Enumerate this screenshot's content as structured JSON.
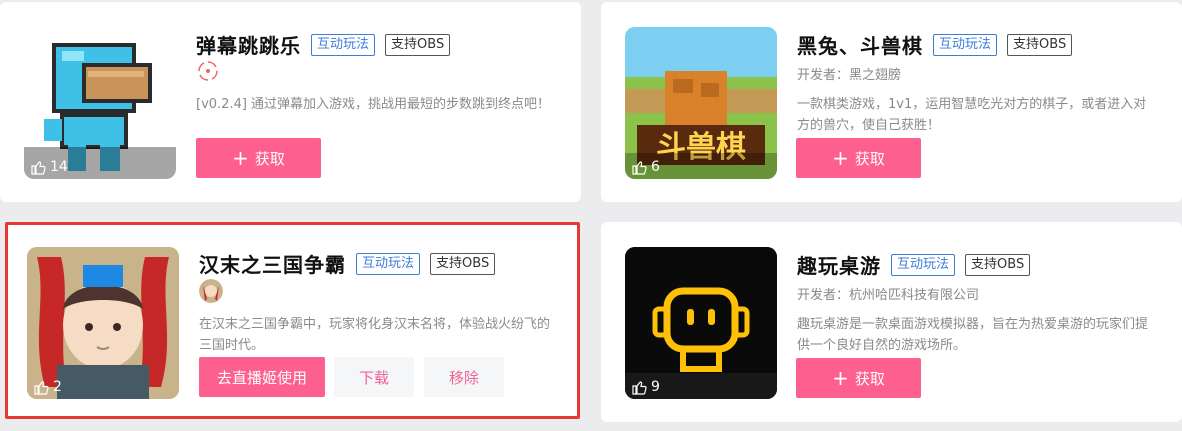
{
  "cards": [
    {
      "title": "弹幕跳跳乐",
      "tag_interactive": "互动玩法",
      "tag_obs": "支持OBS",
      "developer": "",
      "description": "[v0.2.4] 通过弹幕加入游戏，挑战用最短的步数跳到终点吧！",
      "likes": "14",
      "button": "获取",
      "button_icon": "+"
    },
    {
      "title": "黑兔、斗兽棋",
      "tag_interactive": "互动玩法",
      "tag_obs": "支持OBS",
      "developer": "开发者：黑之翅膀",
      "description": "一款棋类游戏，1v1，运用智慧吃光对方的棋子，或者进入对方的兽穴，使自己获胜！",
      "likes": "6",
      "button": "获取",
      "button_icon": "+",
      "thumb_text": "斗兽棋"
    },
    {
      "title": "汉末之三国争霸",
      "tag_interactive": "互动玩法",
      "tag_obs": "支持OBS",
      "developer": "",
      "description": "在汉末之三国争霸中，玩家将化身汉末名将，体验战火纷飞的三国时代。",
      "likes": "2",
      "button_primary": "去直播姬使用",
      "button_download": "下载",
      "button_remove": "移除"
    },
    {
      "title": "趣玩桌游",
      "tag_interactive": "互动玩法",
      "tag_obs": "支持OBS",
      "developer": "开发者：杭州哈匹科技有限公司",
      "description": "趣玩桌游是一款桌面游戏模拟器，旨在为热爱桌游的玩家们提供一个良好自然的游戏场所。",
      "likes": "9",
      "button": "获取",
      "button_icon": "+"
    }
  ],
  "colors": {
    "accent": "#fd5f8e",
    "selected_border": "#e53935",
    "tag_blue": "#3b7dd8"
  }
}
